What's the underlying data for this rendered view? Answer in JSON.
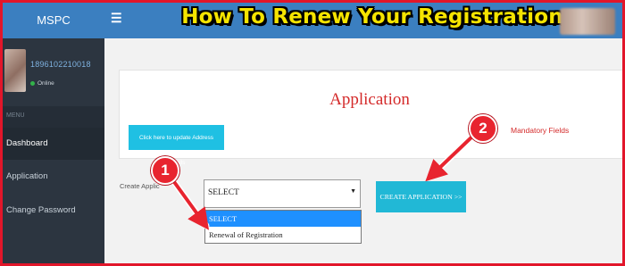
{
  "brand": "MSPC",
  "headline": "How To Renew Your Registration",
  "user": {
    "id": "1896102210018",
    "status": "Online"
  },
  "sidebar": {
    "menu_header": "MENU",
    "items": [
      {
        "label": "Dashboard"
      },
      {
        "label": "Application"
      },
      {
        "label": "Change Password"
      }
    ]
  },
  "panel": {
    "title": "Application",
    "update_address_button": "Click here to update Address Details",
    "mandatory_text": "Mandatory Fields"
  },
  "form": {
    "create_label": "Create Applic",
    "select_value": "SELECT",
    "options": [
      "SELECT",
      "Renewal of Registration"
    ],
    "create_button": "CREATE APPLICATION >>"
  },
  "annotations": {
    "marker1": "1",
    "marker2": "2"
  },
  "colors": {
    "accent": "#3b7fc0",
    "sidebar": "#2c3540",
    "cta": "#21b8d6",
    "highlight": "#f5e400",
    "annotation": "#e8242f"
  },
  "icons": {
    "menu": "hamburger-icon",
    "caret": "caret-down-icon",
    "status": "online-dot-icon"
  }
}
